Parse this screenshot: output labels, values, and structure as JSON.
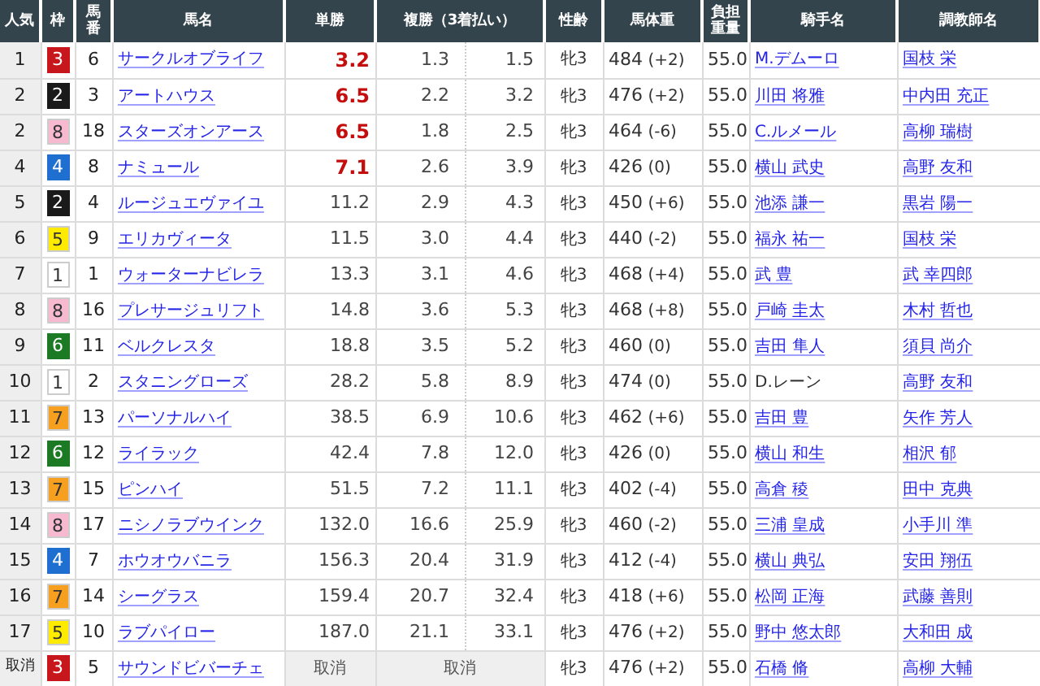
{
  "table": {
    "columns": [
      "人気",
      "枠",
      "馬番",
      "馬名",
      "単勝",
      "複勝（3着払い）",
      "性齢",
      "馬体重",
      "負担重量",
      "騎手名",
      "調教師名"
    ],
    "rows": [
      {
        "kind": "runner",
        "rank": "1",
        "frame": "3",
        "color": "#c8161d",
        "number": "6",
        "name": "サークルオブライフ",
        "win": "3.2",
        "favored": true,
        "place_low": "1.3",
        "place_high": "1.5",
        "sex_age": "牝3",
        "weight": "484",
        "weight_change": "(+2)",
        "burden": "55.0",
        "jockey": "M.デムーロ",
        "jockey_linked": true,
        "trainer": "国枝 栄"
      },
      {
        "kind": "runner",
        "rank": "2",
        "frame": "2",
        "color": "#1a1a1a",
        "number": "3",
        "name": "アートハウス",
        "win": "6.5",
        "favored": true,
        "place_low": "2.2",
        "place_high": "3.2",
        "sex_age": "牝3",
        "weight": "476",
        "weight_change": "(+2)",
        "burden": "55.0",
        "jockey": "川田 将雅",
        "jockey_linked": true,
        "trainer": "中内田 充正"
      },
      {
        "kind": "runner",
        "rank": "2",
        "frame": "8",
        "color": "#f6b9cf",
        "number": "18",
        "name": "スターズオンアース",
        "win": "6.5",
        "favored": true,
        "place_low": "1.8",
        "place_high": "2.5",
        "sex_age": "牝3",
        "weight": "464",
        "weight_change": "(-6)",
        "burden": "55.0",
        "jockey": "C.ルメール",
        "jockey_linked": true,
        "trainer": "高柳 瑞樹"
      },
      {
        "kind": "runner",
        "rank": "4",
        "frame": "4",
        "color": "#1f6fd1",
        "number": "8",
        "name": "ナミュール",
        "win": "7.1",
        "favored": true,
        "place_low": "2.6",
        "place_high": "3.9",
        "sex_age": "牝3",
        "weight": "426",
        "weight_change": "(0)",
        "burden": "55.0",
        "jockey": "横山 武史",
        "jockey_linked": true,
        "trainer": "高野 友和"
      },
      {
        "kind": "runner",
        "rank": "5",
        "frame": "2",
        "color": "#1a1a1a",
        "number": "4",
        "name": "ルージュエヴァイユ",
        "win": "11.2",
        "favored": false,
        "place_low": "2.9",
        "place_high": "4.3",
        "sex_age": "牝3",
        "weight": "450",
        "weight_change": "(+6)",
        "burden": "55.0",
        "jockey": "池添 謙一",
        "jockey_linked": true,
        "trainer": "黒岩 陽一"
      },
      {
        "kind": "runner",
        "rank": "6",
        "frame": "5",
        "color": "#ffeb00",
        "number": "9",
        "name": "エリカヴィータ",
        "win": "11.5",
        "favored": false,
        "place_low": "3.0",
        "place_high": "4.4",
        "sex_age": "牝3",
        "weight": "440",
        "weight_change": "(-2)",
        "burden": "55.0",
        "jockey": "福永 祐一",
        "jockey_linked": true,
        "trainer": "国枝 栄"
      },
      {
        "kind": "runner",
        "rank": "7",
        "frame": "1",
        "color": "#ffffff",
        "number": "1",
        "name": "ウォーターナビレラ",
        "win": "13.3",
        "favored": false,
        "place_low": "3.1",
        "place_high": "4.6",
        "sex_age": "牝3",
        "weight": "468",
        "weight_change": "(+4)",
        "burden": "55.0",
        "jockey": "武 豊",
        "jockey_linked": true,
        "trainer": "武 幸四郎"
      },
      {
        "kind": "runner",
        "rank": "8",
        "frame": "8",
        "color": "#f6b9cf",
        "number": "16",
        "name": "プレサージュリフト",
        "win": "14.8",
        "favored": false,
        "place_low": "3.6",
        "place_high": "5.3",
        "sex_age": "牝3",
        "weight": "468",
        "weight_change": "(+8)",
        "burden": "55.0",
        "jockey": "戸崎 圭太",
        "jockey_linked": true,
        "trainer": "木村 哲也"
      },
      {
        "kind": "runner",
        "rank": "9",
        "frame": "6",
        "color": "#1c7a25",
        "number": "11",
        "name": "ベルクレスタ",
        "win": "18.8",
        "favored": false,
        "place_low": "3.5",
        "place_high": "5.2",
        "sex_age": "牝3",
        "weight": "460",
        "weight_change": "(0)",
        "burden": "55.0",
        "jockey": "吉田 隼人",
        "jockey_linked": true,
        "trainer": "須貝 尚介"
      },
      {
        "kind": "runner",
        "rank": "10",
        "frame": "1",
        "color": "#ffffff",
        "number": "2",
        "name": "スタニングローズ",
        "win": "28.2",
        "favored": false,
        "place_low": "5.8",
        "place_high": "8.9",
        "sex_age": "牝3",
        "weight": "474",
        "weight_change": "(0)",
        "burden": "55.0",
        "jockey": "D.レーン",
        "jockey_linked": false,
        "trainer": "高野 友和"
      },
      {
        "kind": "runner",
        "rank": "11",
        "frame": "7",
        "color": "#f7a020",
        "number": "13",
        "name": "パーソナルハイ",
        "win": "38.5",
        "favored": false,
        "place_low": "6.9",
        "place_high": "10.6",
        "sex_age": "牝3",
        "weight": "462",
        "weight_change": "(+6)",
        "burden": "55.0",
        "jockey": "吉田 豊",
        "jockey_linked": true,
        "trainer": "矢作 芳人"
      },
      {
        "kind": "runner",
        "rank": "12",
        "frame": "6",
        "color": "#1c7a25",
        "number": "12",
        "name": "ライラック",
        "win": "42.4",
        "favored": false,
        "place_low": "7.8",
        "place_high": "12.0",
        "sex_age": "牝3",
        "weight": "426",
        "weight_change": "(0)",
        "burden": "55.0",
        "jockey": "横山 和生",
        "jockey_linked": true,
        "trainer": "相沢 郁"
      },
      {
        "kind": "runner",
        "rank": "13",
        "frame": "7",
        "color": "#f7a020",
        "number": "15",
        "name": "ピンハイ",
        "win": "51.5",
        "favored": false,
        "place_low": "7.2",
        "place_high": "11.1",
        "sex_age": "牝3",
        "weight": "402",
        "weight_change": "(-4)",
        "burden": "55.0",
        "jockey": "高倉 稜",
        "jockey_linked": true,
        "trainer": "田中 克典"
      },
      {
        "kind": "runner",
        "rank": "14",
        "frame": "8",
        "color": "#f6b9cf",
        "number": "17",
        "name": "ニシノラブウインク",
        "win": "132.0",
        "favored": false,
        "place_low": "16.6",
        "place_high": "25.9",
        "sex_age": "牝3",
        "weight": "460",
        "weight_change": "(-2)",
        "burden": "55.0",
        "jockey": "三浦 皇成",
        "jockey_linked": true,
        "trainer": "小手川 準"
      },
      {
        "kind": "runner",
        "rank": "15",
        "frame": "4",
        "color": "#1f6fd1",
        "number": "7",
        "name": "ホウオウバニラ",
        "win": "156.3",
        "favored": false,
        "place_low": "20.4",
        "place_high": "31.9",
        "sex_age": "牝3",
        "weight": "412",
        "weight_change": "(-4)",
        "burden": "55.0",
        "jockey": "横山 典弘",
        "jockey_linked": true,
        "trainer": "安田 翔伍"
      },
      {
        "kind": "runner",
        "rank": "16",
        "frame": "7",
        "color": "#f7a020",
        "number": "14",
        "name": "シーグラス",
        "win": "159.4",
        "favored": false,
        "place_low": "20.7",
        "place_high": "32.4",
        "sex_age": "牝3",
        "weight": "418",
        "weight_change": "(+6)",
        "burden": "55.0",
        "jockey": "松岡 正海",
        "jockey_linked": true,
        "trainer": "武藤 善則"
      },
      {
        "kind": "runner",
        "rank": "17",
        "frame": "5",
        "color": "#ffeb00",
        "number": "10",
        "name": "ラブパイロー",
        "win": "187.0",
        "favored": false,
        "place_low": "21.1",
        "place_high": "33.1",
        "sex_age": "牝3",
        "weight": "476",
        "weight_change": "(+2)",
        "burden": "55.0",
        "jockey": "野中 悠太郎",
        "jockey_linked": true,
        "trainer": "大和田 成"
      },
      {
        "kind": "scratched",
        "rank": "取消",
        "frame": "3",
        "color": "#c8161d",
        "number": "5",
        "name": "サウンドビバーチェ",
        "win": "取消",
        "place": "取消",
        "sex_age": "牝3",
        "weight": "476",
        "weight_change": "(+2)",
        "burden": "55.0",
        "jockey": "石橋 脩",
        "jockey_linked": true,
        "trainer": "高柳 大輔"
      }
    ]
  }
}
